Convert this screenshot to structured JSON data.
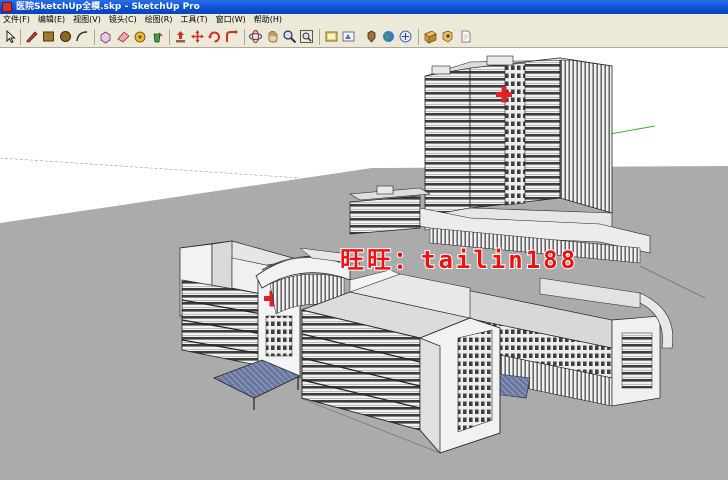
{
  "window": {
    "title": "医院SketchUp全模.skp - SketchUp Pro"
  },
  "menu": {
    "items": [
      "文件(F)",
      "编辑(E)",
      "视图(V)",
      "镜头(C)",
      "绘图(R)",
      "工具(T)",
      "窗口(W)",
      "帮助(H)"
    ]
  },
  "toolbar": {
    "tools": [
      {
        "name": "select-icon",
        "color": "#222222"
      },
      {
        "name": "pencil-icon",
        "color": "#c8402a"
      },
      {
        "name": "rectangle-icon",
        "color": "#8a6a2a"
      },
      {
        "name": "circle-icon",
        "color": "#7a5a20"
      },
      {
        "name": "arc-icon",
        "color": "#444444"
      },
      {
        "name": "make-component-icon",
        "color": "#c89ac8"
      },
      {
        "name": "eraser-icon",
        "color": "#e89aa0"
      },
      {
        "name": "tape-measure-icon",
        "color": "#d4a020"
      },
      {
        "name": "paint-bucket-icon",
        "color": "#3a7a3a"
      },
      {
        "name": "push-pull-icon",
        "color": "#c83020"
      },
      {
        "name": "move-icon",
        "color": "#c83020"
      },
      {
        "name": "rotate-icon",
        "color": "#c83020"
      },
      {
        "name": "follow-me-icon",
        "color": "#c83020"
      },
      {
        "name": "orbit-icon",
        "color": "#2a5aa8"
      },
      {
        "name": "pan-icon",
        "color": "#c8a050"
      },
      {
        "name": "zoom-icon",
        "color": "#555555"
      },
      {
        "name": "zoom-extents-icon",
        "color": "#555555"
      },
      {
        "name": "get-models-icon",
        "color": "#d4a020"
      },
      {
        "name": "share-model-icon",
        "color": "#3a7ac8"
      },
      {
        "name": "place-model-icon",
        "color": "#8a5a30"
      },
      {
        "name": "google-earth-icon",
        "color": "#2a8a4a"
      },
      {
        "name": "share-component-icon",
        "color": "#3a6aa8"
      },
      {
        "name": "section-plane-icon",
        "color": "#d4a040"
      },
      {
        "name": "page-icon",
        "color": "#777777"
      }
    ]
  },
  "viewport": {
    "watermark": "旺旺：tailin188",
    "colors": {
      "ground": "#ababab",
      "wall": "#f1f1f1",
      "roof": "#dcdcdc",
      "window_dark": "#3d3d3d",
      "glass": "#6a78a0",
      "red_cross": "#e02222",
      "green_axis": "#3ab03a",
      "red_axis": "#e04040"
    }
  }
}
